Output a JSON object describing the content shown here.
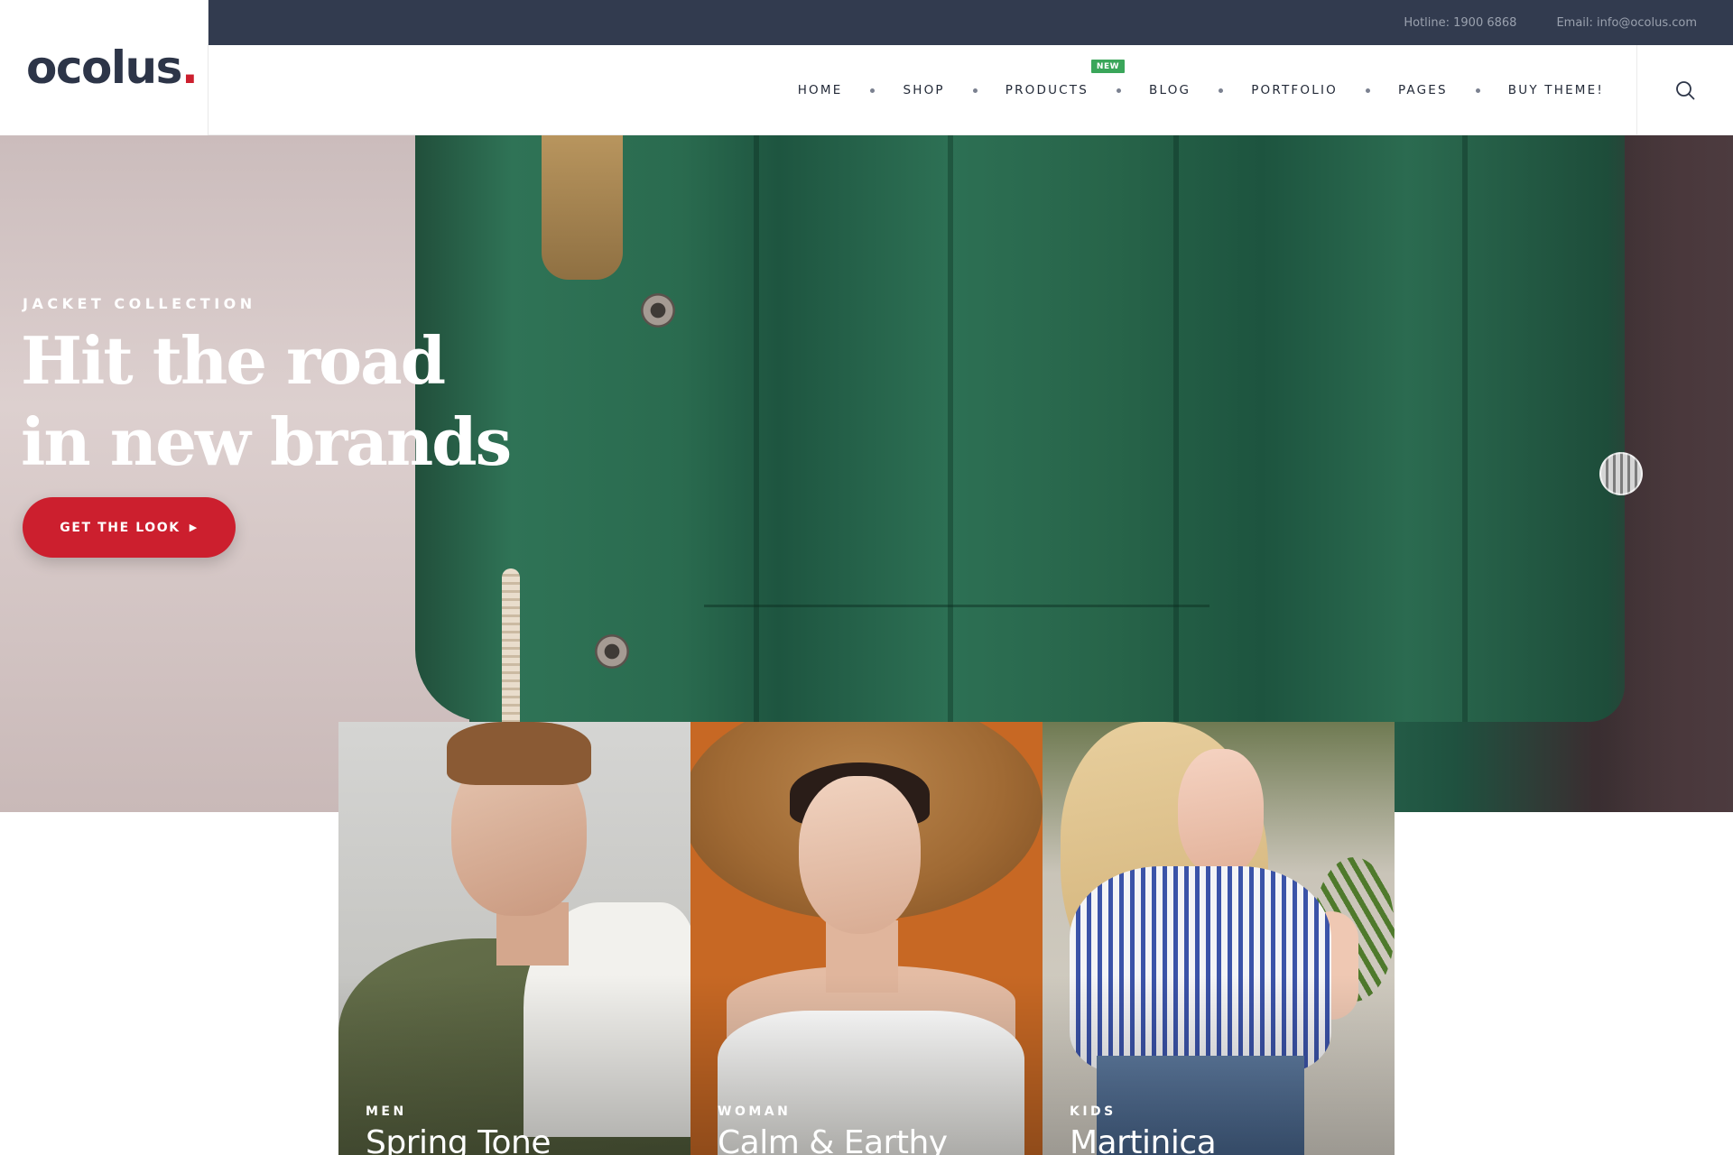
{
  "brand": {
    "name": "ocolus",
    "dot": ".",
    "accent": "#cc1f2e",
    "dark": "#323b4f"
  },
  "topbar": {
    "hotline": "Hotline: 1900 6868",
    "email": "Email: info@ocolus.com"
  },
  "nav": {
    "items": [
      {
        "label": "HOME"
      },
      {
        "label": "SHOP"
      },
      {
        "label": "PRODUCTS",
        "badge": "NEW"
      },
      {
        "label": "BLOG"
      },
      {
        "label": "PORTFOLIO"
      },
      {
        "label": "PAGES"
      },
      {
        "label": "BUY THEME!"
      }
    ],
    "badge_color": "#3aa65a",
    "search_icon": "search-icon"
  },
  "hero": {
    "eyebrow": "JACKET COLLECTION",
    "title_line1": "Hit the road",
    "title_line2": "in new brands",
    "cta_label": "GET THE LOOK",
    "cta_icon": "caret-right-icon"
  },
  "categories": [
    {
      "kicker": "MEN",
      "title": "Spring Tone"
    },
    {
      "kicker": "WOMAN",
      "title": "Calm & Earthy"
    },
    {
      "kicker": "KIDS",
      "title": "Martinica"
    }
  ]
}
